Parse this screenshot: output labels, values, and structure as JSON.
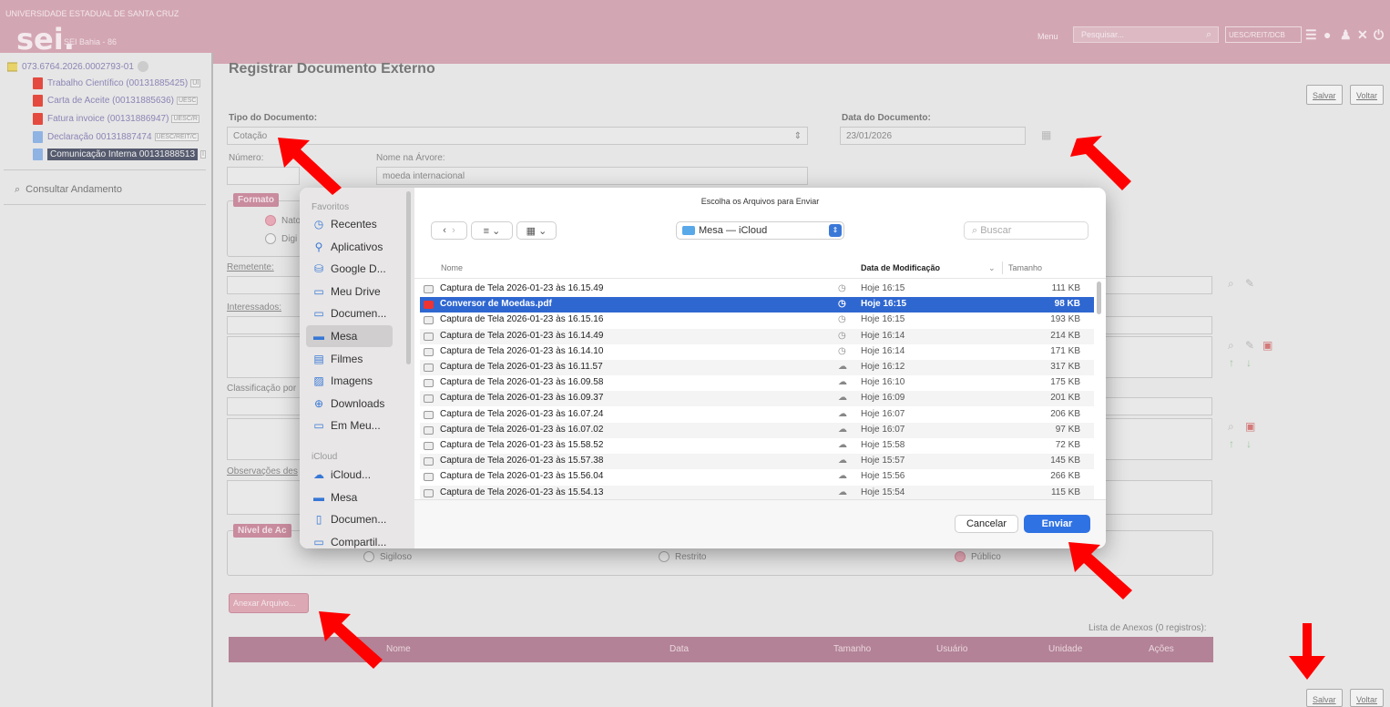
{
  "header": {
    "university": "UNIVERSIDADE ESTADUAL DE SANTA CRUZ",
    "logo": "sei.",
    "subtitle": "SEI Bahia - 86",
    "menu_label": "Menu",
    "search_placeholder": "Pesquisar...",
    "unit": "UESC/REIT/DCB"
  },
  "tree": {
    "process": "073.6764.2026.0002793-01",
    "items": [
      {
        "label": "Trabalho Científico (00131885425)",
        "badge": "UI",
        "type": "pdf"
      },
      {
        "label": "Carta de Aceite (00131885636)",
        "badge": "UESC",
        "type": "pdf"
      },
      {
        "label": "Fatura invoice (00131886947)",
        "badge": "UESC/R",
        "type": "pdf"
      },
      {
        "label": "Declaração 00131887474",
        "badge": "UESC/REIT/C",
        "type": "doc"
      },
      {
        "label": "Comunicação Interna 00131888513",
        "badge": "I",
        "type": "doc"
      }
    ],
    "consult": "Consultar Andamento"
  },
  "form": {
    "title": "Registrar Documento Externo",
    "save": "Salvar",
    "back": "Voltar",
    "tipo_label": "Tipo do Documento:",
    "tipo_value": "Cotação",
    "data_label": "Data do Documento:",
    "data_value": "23/01/2026",
    "numero_label": "Número:",
    "nome_arvore_label": "Nome na Árvore:",
    "nome_arvore_value": "moeda internacional",
    "formato_legend": "Formato",
    "formato_nato": "Nato",
    "formato_digi": "Digi",
    "remetente_label": "Remetente:",
    "interessados_label": "Interessados:",
    "classificacao_label": "Classificação por",
    "observacoes_label": "Observações des",
    "nivel_legend": "Nível de Ac",
    "sigiloso": "Sigiloso",
    "restrito": "Restrito",
    "publico": "Público",
    "anexar": "Anexar Arquivo...",
    "anexos_caption": "Lista de Anexos (0 registros):",
    "anexos_cols": [
      "Nome",
      "Data",
      "Tamanho",
      "Usuário",
      "Unidade",
      "Ações"
    ]
  },
  "dialog": {
    "title": "Escolha os Arquivos para Enviar",
    "location": "Mesa — iCloud",
    "search_placeholder": "Buscar",
    "sidebar_fav_head": "Favoritos",
    "sidebar_fav": [
      {
        "label": "Recentes",
        "icon": "clock-icon"
      },
      {
        "label": "Aplicativos",
        "icon": "apps-icon"
      },
      {
        "label": "Google D...",
        "icon": "drive-icon"
      },
      {
        "label": "Meu Drive",
        "icon": "folder-icon"
      },
      {
        "label": "Documen...",
        "icon": "folder-icon"
      },
      {
        "label": "Mesa",
        "icon": "desktop-icon"
      },
      {
        "label": "Filmes",
        "icon": "film-icon"
      },
      {
        "label": "Imagens",
        "icon": "image-icon"
      },
      {
        "label": "Downloads",
        "icon": "download-icon"
      },
      {
        "label": "Em Meu...",
        "icon": "folder-icon"
      }
    ],
    "sidebar_icloud_head": "iCloud",
    "sidebar_icloud": [
      {
        "label": "iCloud...",
        "icon": "cloud-icon"
      },
      {
        "label": "Mesa",
        "icon": "desktop-icon"
      },
      {
        "label": "Documen...",
        "icon": "doc-icon"
      },
      {
        "label": "Compartil...",
        "icon": "shared-folder-icon"
      }
    ],
    "col_name": "Nome",
    "col_date": "Data de Modificação",
    "col_size": "Tamanho",
    "files": [
      {
        "name": "Captura de Tela 2026-01-23 às 16.15.49",
        "date": "Hoje 16:15",
        "size": "111 KB",
        "status": "clock"
      },
      {
        "name": "Conversor de Moedas.pdf",
        "date": "Hoje 16:15",
        "size": "98 KB",
        "status": "clock",
        "selected": true
      },
      {
        "name": "Captura de Tela 2026-01-23 às 16.15.16",
        "date": "Hoje 16:15",
        "size": "193 KB",
        "status": "clock"
      },
      {
        "name": "Captura de Tela 2026-01-23 às 16.14.49",
        "date": "Hoje 16:14",
        "size": "214 KB",
        "status": "clock"
      },
      {
        "name": "Captura de Tela 2026-01-23 às 16.14.10",
        "date": "Hoje 16:14",
        "size": "171 KB",
        "status": "clock"
      },
      {
        "name": "Captura de Tela 2026-01-23 às 16.11.57",
        "date": "Hoje 16:12",
        "size": "317 KB",
        "status": "cloud"
      },
      {
        "name": "Captura de Tela 2026-01-23 às 16.09.58",
        "date": "Hoje 16:10",
        "size": "175 KB",
        "status": "cloud"
      },
      {
        "name": "Captura de Tela 2026-01-23 às 16.09.37",
        "date": "Hoje 16:09",
        "size": "201 KB",
        "status": "cloud"
      },
      {
        "name": "Captura de Tela 2026-01-23 às 16.07.24",
        "date": "Hoje 16:07",
        "size": "206 KB",
        "status": "cloud"
      },
      {
        "name": "Captura de Tela 2026-01-23 às 16.07.02",
        "date": "Hoje 16:07",
        "size": "97 KB",
        "status": "cloud"
      },
      {
        "name": "Captura de Tela 2026-01-23 às 15.58.52",
        "date": "Hoje 15:58",
        "size": "72 KB",
        "status": "cloud"
      },
      {
        "name": "Captura de Tela 2026-01-23 às 15.57.38",
        "date": "Hoje 15:57",
        "size": "145 KB",
        "status": "cloud"
      },
      {
        "name": "Captura de Tela 2026-01-23 às 15.56.04",
        "date": "Hoje 15:56",
        "size": "266 KB",
        "status": "cloud"
      },
      {
        "name": "Captura de Tela 2026-01-23 às 15.54.13",
        "date": "Hoje 15:54",
        "size": "115 KB",
        "status": "cloud"
      }
    ],
    "cancel": "Cancelar",
    "send": "Enviar"
  },
  "colors": {
    "brand": "#d3a6b3",
    "selection": "#2f67d1",
    "primary_button": "#2f72e3",
    "annotation_arrow": "#ff0000"
  }
}
